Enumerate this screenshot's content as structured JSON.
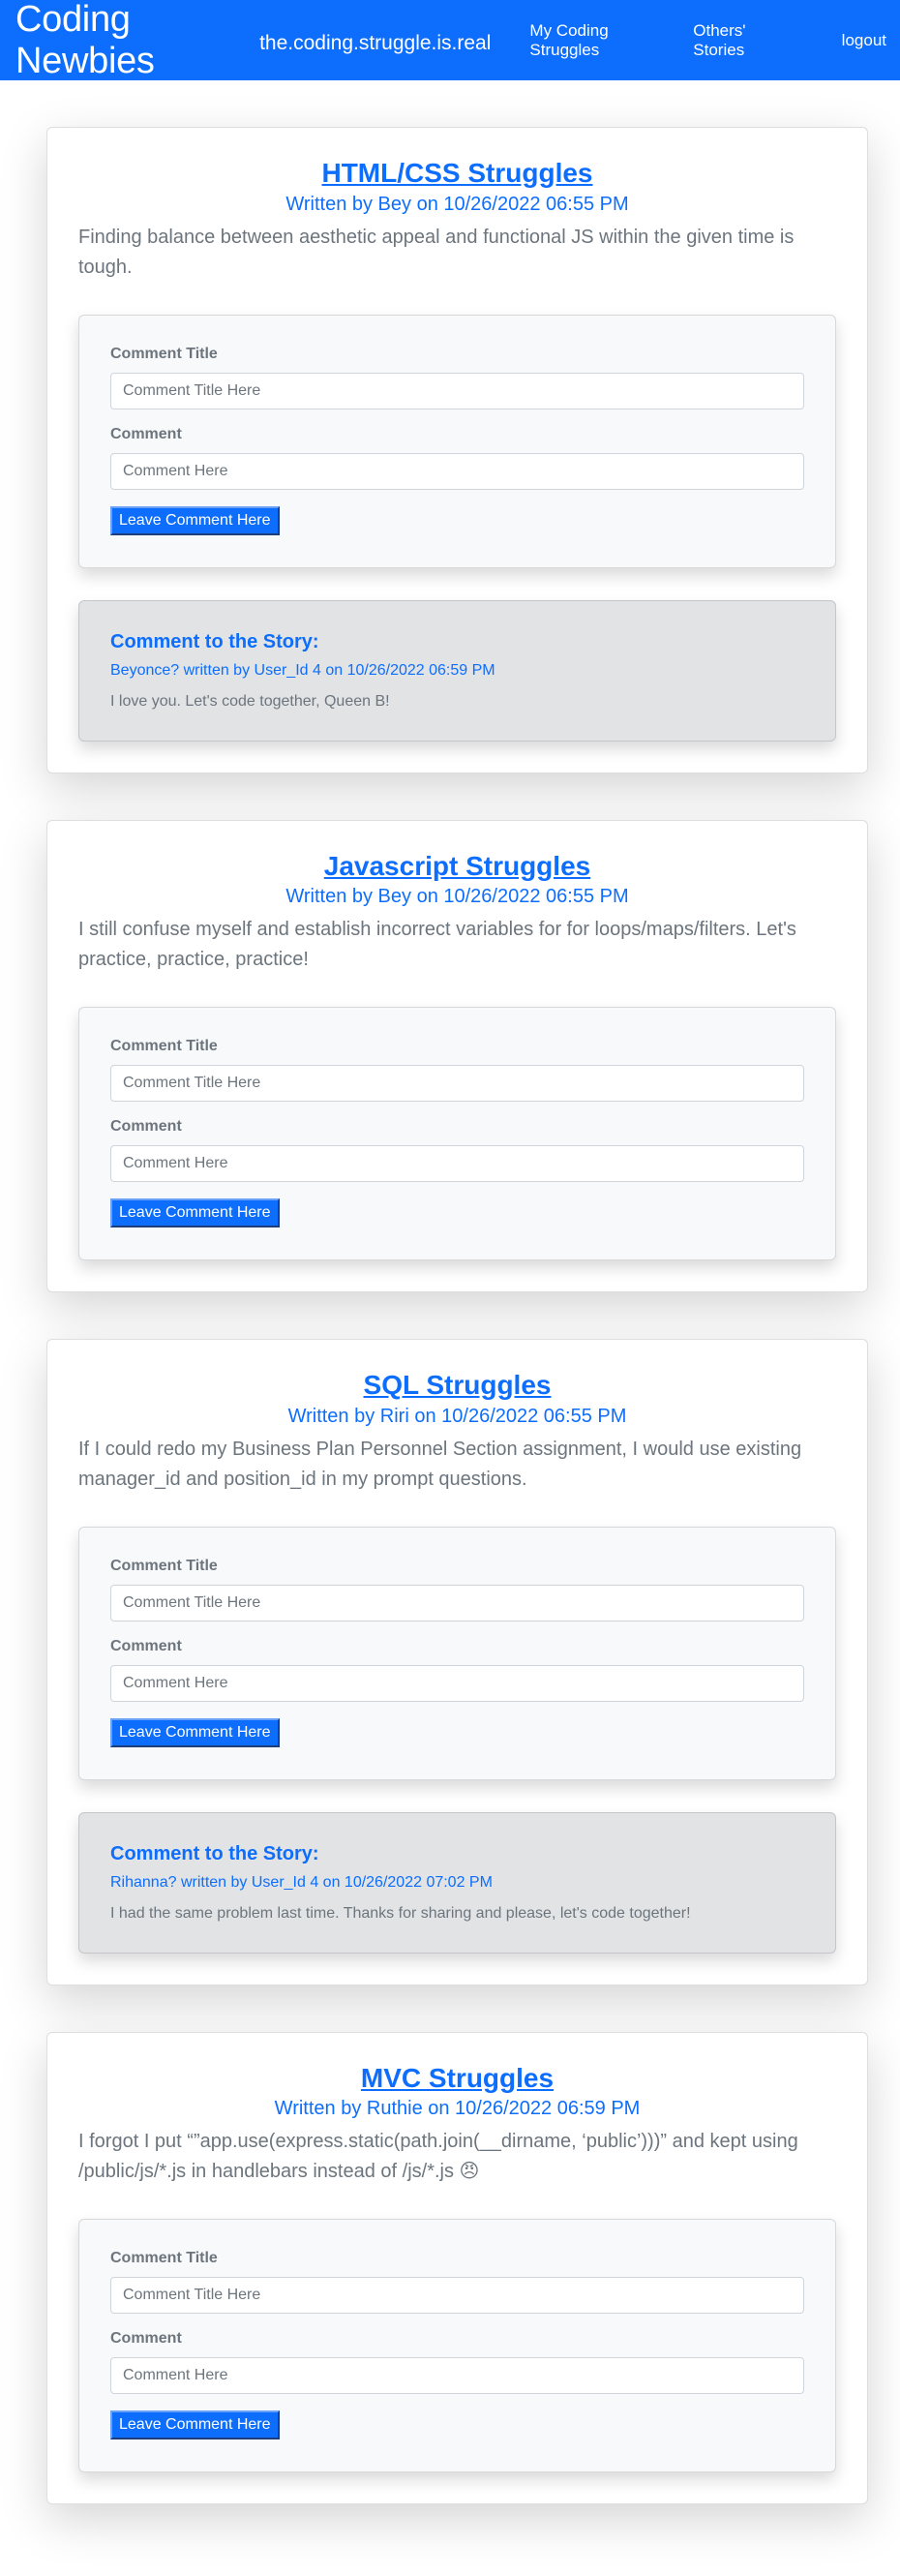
{
  "nav": {
    "brand": "Coding Newbies",
    "tagline": "the.coding.struggle.is.real",
    "links": [
      "My Coding Struggles",
      "Others' Stories",
      "logout"
    ]
  },
  "form": {
    "title_label": "Comment Title",
    "title_placeholder": "Comment Title Here",
    "comment_label": "Comment",
    "comment_placeholder": "Comment Here",
    "submit_label": "Leave Comment Here"
  },
  "comment_heading": "Comment to the Story:",
  "posts": [
    {
      "title": "HTML/CSS Struggles",
      "meta": "Written by Bey on 10/26/2022 06:55 PM",
      "body": "Finding balance between aesthetic appeal and functional JS within the given time is tough.",
      "comment": {
        "meta": "Beyonce? written by User_Id 4 on 10/26/2022 06:59 PM",
        "text": "I love you. Let's code together, Queen B!"
      }
    },
    {
      "title": "Javascript Struggles",
      "meta": "Written by Bey on 10/26/2022 06:55 PM",
      "body": "I still confuse myself and establish incorrect variables for for loops/maps/filters. Let's practice, practice, practice!"
    },
    {
      "title": "SQL Struggles",
      "meta": "Written by Riri on 10/26/2022 06:55 PM",
      "body": "If I could redo my Business Plan Personnel Section assignment, I would use existing manager_id and position_id in my prompt questions.",
      "comment": {
        "meta": "Rihanna? written by User_Id 4 on 10/26/2022 07:02 PM",
        "text": "I had the same problem last time. Thanks for sharing and please, let's code together!"
      }
    },
    {
      "title": "MVC Struggles",
      "meta": "Written by Ruthie on 10/26/2022 06:59 PM",
      "body": "I forgot I put “”app.use(express.static(path.join(__dirname, ‘public’)))” and kept using /public/js/*.js in handlebars instead of /js/*.js 😠"
    }
  ]
}
